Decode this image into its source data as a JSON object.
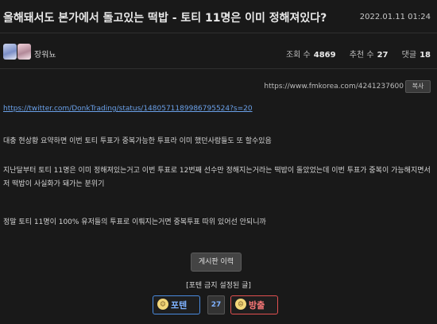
{
  "post": {
    "title": "올해돼서도 본가에서 돌고있는 떡밥 - 토티 11명은 이미 정해져있다?",
    "date": "2022.01.11 01:24",
    "author": "장워뇨",
    "views_label": "조회 수",
    "views": "4869",
    "recommend_label": "추천 수",
    "recommend": "27",
    "comments_label": "댓글",
    "comments": "18"
  },
  "permalink": {
    "url": "https://www.fmkorea.com/4241237600",
    "copy_label": "복사"
  },
  "body": {
    "link": "https://twitter.com/DonkTrading/status/1480571189986795524?s=20",
    "para1": "대충 현상황 요약하면 이번 토티 투표가 중복가능한 투표라 이미 했던사람들도 또 할수있음",
    "para2": "지난달부터 토티 11명은 이미 정해져있는거고 이번 투표로 12번째 선수만 정해지는거라는 떡밥이 돌았었는데 이번 투표가 중복이 가능해지면서 저 떡밥이 사실화가 돼가는 분위기",
    "para3": "정말 토티 11명이 100% 유저들의 투표로 이뤄지는거면 중복투표 따위 있어선 안되니까"
  },
  "footer": {
    "board_history": "게시판 이력",
    "vote_title": "[포텐 금지 설정된 글]",
    "upvote_label": "포텐",
    "vote_count": "27",
    "downvote_label": "방출"
  }
}
